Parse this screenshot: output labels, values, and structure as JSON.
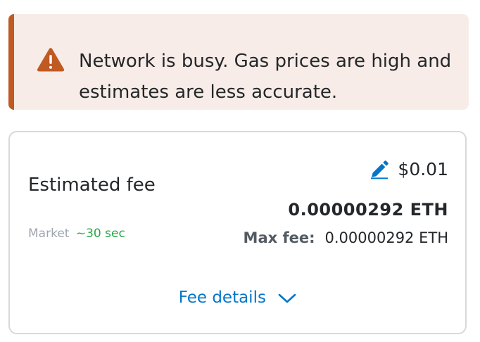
{
  "warning_banner": {
    "line1": "Network is busy. Gas prices are high and",
    "line2": "estimates are less accurate.",
    "accent_color": "#bf5a23",
    "icon": "warning-icon"
  },
  "fee_card": {
    "label": "Estimated fee",
    "fiat_value": "$0.01",
    "edit_icon": "pencil-icon",
    "eth_value": "0.00000292 ETH",
    "speed_label": "Market",
    "speed_time": "~30 sec",
    "max_fee_label": "Max fee:",
    "max_fee_value": "0.00000292 ETH",
    "details_link": "Fee details",
    "link_color": "#0376c9",
    "speed_color": "#28a745"
  }
}
